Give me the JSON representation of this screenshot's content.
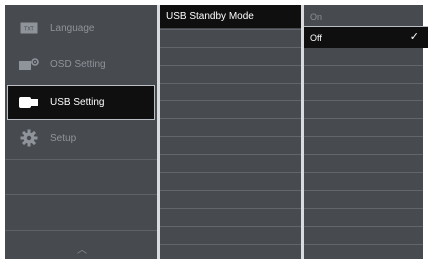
{
  "menu": {
    "items": [
      {
        "label": "Language",
        "icon": "language-icon"
      },
      {
        "label": "OSD Setting",
        "icon": "osd-setting-icon"
      },
      {
        "label": "USB Setting",
        "icon": "usb-icon"
      },
      {
        "label": "Setup",
        "icon": "gear-icon"
      }
    ],
    "active_index": 2,
    "language_icon_text": "TXT"
  },
  "submenu": {
    "selected_label": "USB Standby Mode"
  },
  "options": {
    "on_label": "On",
    "off_label": "Off",
    "selected": "Off"
  },
  "colors": {
    "panel": "#474a4f",
    "selected": "#0f0f10",
    "text_inactive": "#8f949b",
    "text_active": "#ffffff",
    "divider": "#d9dbde"
  }
}
